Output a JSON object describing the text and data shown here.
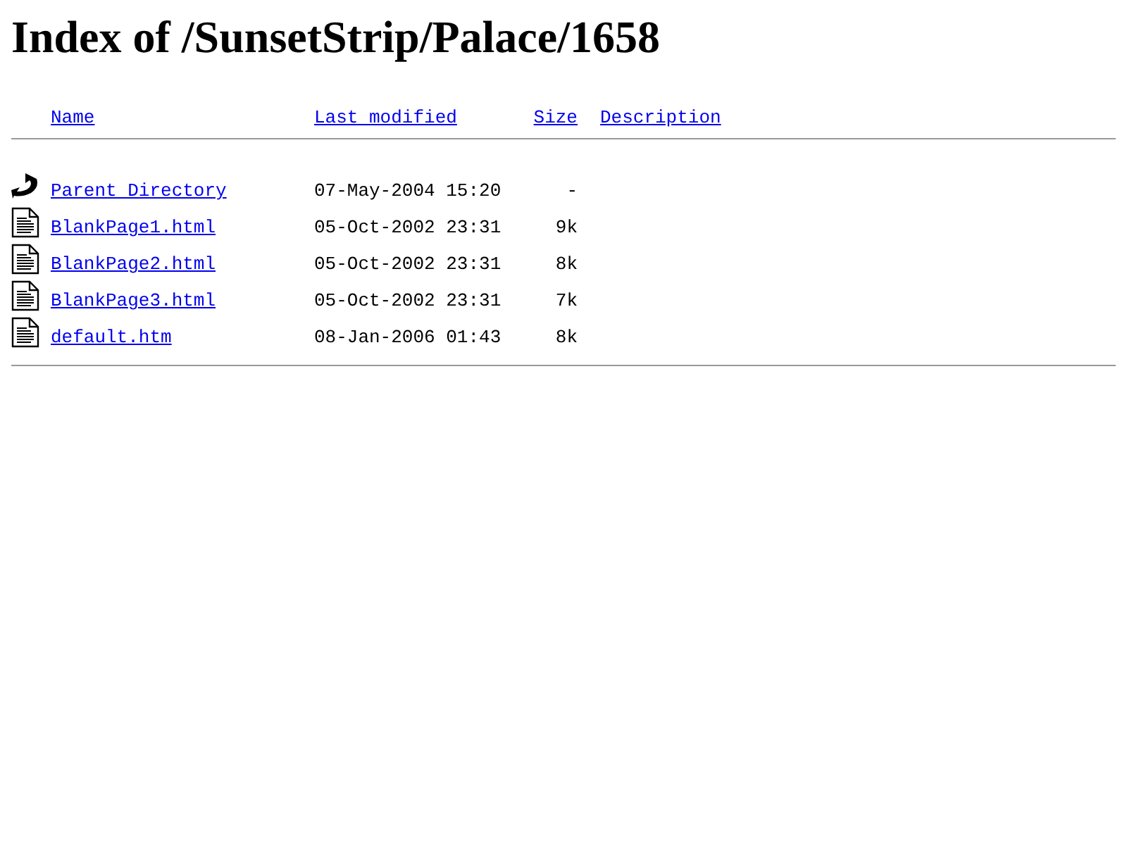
{
  "title": "Index of /SunsetStrip/Palace/1658",
  "columns": [
    {
      "label": "Name"
    },
    {
      "label": "Last modified"
    },
    {
      "label": "Size"
    },
    {
      "label": "Description"
    }
  ],
  "rows": [
    {
      "kind": "parent",
      "name": "Parent Directory",
      "modified": "07-May-2004 15:20",
      "size": "-"
    },
    {
      "kind": "file",
      "name": "BlankPage1.html",
      "modified": "05-Oct-2002 23:31",
      "size": "9k"
    },
    {
      "kind": "file",
      "name": "BlankPage2.html",
      "modified": "05-Oct-2002 23:31",
      "size": "8k"
    },
    {
      "kind": "file",
      "name": "BlankPage3.html",
      "modified": "05-Oct-2002 23:31",
      "size": "7k"
    },
    {
      "kind": "file",
      "name": "default.htm",
      "modified": "08-Jan-2006 01:43",
      "size": "8k"
    }
  ]
}
